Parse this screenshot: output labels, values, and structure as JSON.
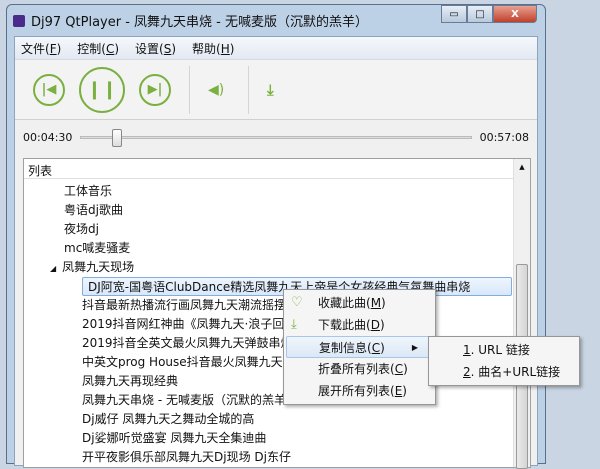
{
  "window": {
    "title": "Dj97 QtPlayer - 凤舞九天串烧 - 无喊麦版（沉默的羔羊）",
    "controls": {
      "minimize": "▭",
      "maximize": "□",
      "close": "X"
    }
  },
  "menubar": [
    {
      "label": "文件(",
      "key": "F",
      "end": ")"
    },
    {
      "label": "控制(",
      "key": "C",
      "end": ")"
    },
    {
      "label": "设置(",
      "key": "S",
      "end": ")"
    },
    {
      "label": "帮助(",
      "key": "H",
      "end": ")"
    }
  ],
  "toolbar": {
    "prev": "prev-icon",
    "pause": "pause-icon",
    "next": "next-icon",
    "volume": "volume-icon",
    "download": "download-icon",
    "accent": "#7ab040"
  },
  "seek": {
    "elapsed": "00:04:30",
    "total": "00:57:08",
    "progress": 0.079
  },
  "list": {
    "header": "列表",
    "categories": [
      "工体音乐",
      "粤语dj歌曲",
      "夜场dj",
      "mc喊麦骚麦"
    ],
    "expanded": "凤舞九天现场",
    "selected": "DJ阿宽-国粤语ClubDance精选凤舞九天上帝是个女孩经典气氛舞曲串烧",
    "tracks": [
      "抖音最新热播流行画凤舞九天潮流摇摆",
      "2019抖音网红神曲《凤舞九天·浪子回",
      "2019抖音全英文最火凤舞九天弹鼓串烧",
      "中英文prog House抖音最火凤舞九天",
      "凤舞九天再现经典",
      "凤舞九天串烧 - 无喊麦版（沉默的羔羊",
      "Dj威仔 凤舞九天之舞动全城的高",
      "Dj娑娜听觉盛宴 凤舞九天全集迪曲",
      "开平夜影俱乐部凤舞九天Dj现场 Dj东仔"
    ]
  },
  "context_menu": [
    {
      "label": "收藏此曲(",
      "key": "M",
      "end": ")",
      "icon": "heart-icon"
    },
    {
      "label": "下载此曲(",
      "key": "D",
      "end": ")",
      "icon": "download-icon"
    },
    {
      "label": "复制信息(",
      "key": "C",
      "end": ")",
      "submenu": true
    },
    {
      "label": "折叠所有列表(",
      "key": "C",
      "end": ")"
    },
    {
      "label": "展开所有列表(",
      "key": "E",
      "end": ")"
    }
  ],
  "submenu": [
    {
      "key": "1",
      "label": ". URL 链接"
    },
    {
      "key": "2",
      "label": ". 曲名+URL链接"
    }
  ]
}
